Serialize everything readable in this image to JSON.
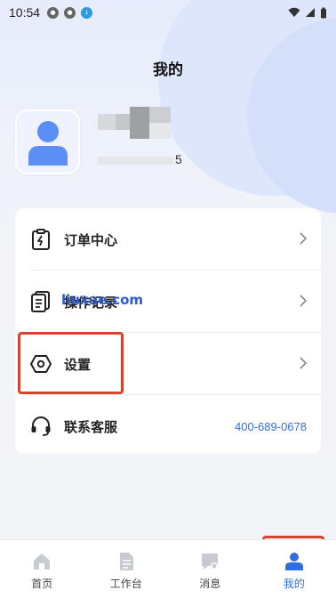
{
  "status_bar": {
    "time": "10:54",
    "icons": [
      "app-icon",
      "app-icon",
      "download-icon"
    ],
    "right_icons": [
      "wifi-icon",
      "signal-icon",
      "battery-icon"
    ]
  },
  "header": {
    "title": "我的"
  },
  "profile": {
    "phone_suffix": "5",
    "avatar_icon": "user-avatar-icon"
  },
  "menu": {
    "items": [
      {
        "label": "订单中心",
        "icon": "clipboard-icon"
      },
      {
        "label": "操作记录",
        "icon": "document-list-icon",
        "overlay": "liuxue.com"
      },
      {
        "label": "设置",
        "icon": "hexagon-settings-icon"
      },
      {
        "label": "联系客服",
        "icon": "headset-icon",
        "phone": "400-689-0678"
      }
    ]
  },
  "bottom_nav": {
    "items": [
      {
        "label": "首页",
        "icon": "home-icon"
      },
      {
        "label": "工作台",
        "icon": "document-icon"
      },
      {
        "label": "消息",
        "icon": "message-icon"
      },
      {
        "label": "我的",
        "icon": "person-icon",
        "active": true
      }
    ]
  },
  "colors": {
    "accent": "#2f6ee0",
    "highlight": "#d4452f",
    "background": "#f2f4f8"
  }
}
